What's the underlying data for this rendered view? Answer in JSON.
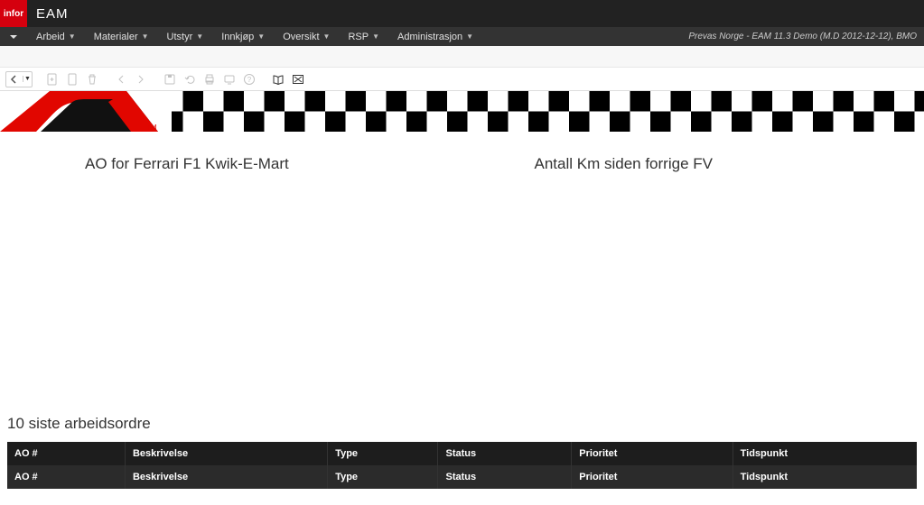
{
  "brand": {
    "logo_text": "infor",
    "title": "EAM"
  },
  "menu": {
    "items": [
      {
        "label": "Arbeid"
      },
      {
        "label": "Materialer"
      },
      {
        "label": "Utstyr"
      },
      {
        "label": "Innkjøp"
      },
      {
        "label": "Oversikt"
      },
      {
        "label": "RSP"
      },
      {
        "label": "Administrasjon"
      }
    ],
    "right_text": "Prevas Norge - EAM 11.3 Demo (M.D 2012-12-12), BMO"
  },
  "toolbar_icons": {
    "back": "back-icon",
    "new_doc": "document-plus-icon",
    "doc": "document-icon",
    "save": "save-icon",
    "trash": "trash-icon",
    "prev": "prev-icon",
    "next": "next-icon",
    "refresh": "refresh-icon",
    "undo": "undo-icon",
    "print": "print-icon",
    "screen": "screen-icon",
    "help": "help-icon",
    "book": "book-open-icon",
    "cancel_img": "image-cancel-icon"
  },
  "panels": {
    "left_title": "AO for Ferrari F1 Kwik-E-Mart",
    "right_title": "Antall Km siden forrige FV"
  },
  "table": {
    "title": "10 siste arbeidsordre",
    "headers": {
      "ao": "AO #",
      "beskrivelse": "Beskrivelse",
      "type": "Type",
      "status": "Status",
      "prioritet": "Prioritet",
      "tidspunkt": "Tidspunkt"
    }
  }
}
